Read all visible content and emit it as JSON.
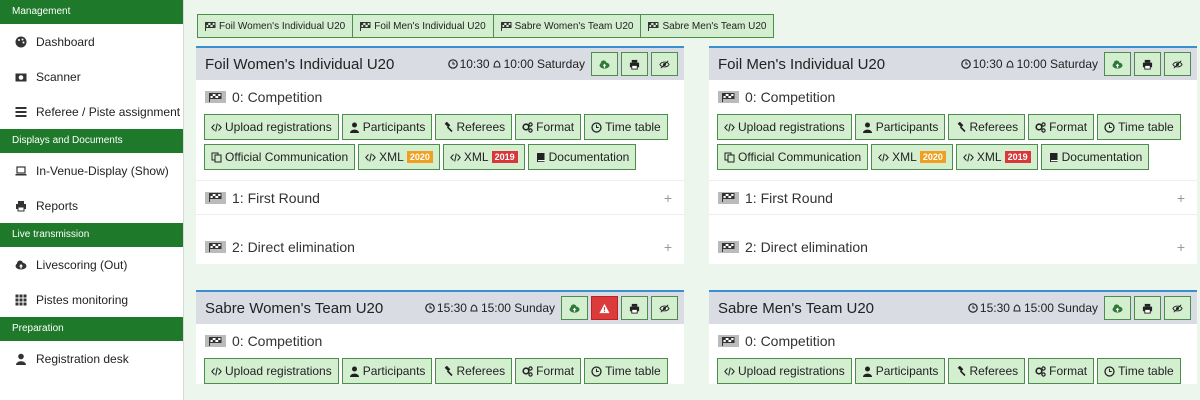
{
  "sidebar": {
    "sections": [
      {
        "title": "Management",
        "items": [
          {
            "label": "Dashboard",
            "icon": "palette-icon"
          },
          {
            "label": "Scanner",
            "icon": "camera-icon"
          },
          {
            "label": "Referee / Piste assignment",
            "icon": "list-icon"
          }
        ]
      },
      {
        "title": "Displays and Documents",
        "items": [
          {
            "label": "In-Venue-Display (Show)",
            "icon": "laptop-icon"
          },
          {
            "label": "Reports",
            "icon": "print-icon"
          }
        ]
      },
      {
        "title": "Live transmission",
        "items": [
          {
            "label": "Livescoring (Out)",
            "icon": "cloud-upload-icon"
          },
          {
            "label": "Pistes monitoring",
            "icon": "grid-icon"
          }
        ]
      },
      {
        "title": "Preparation",
        "items": [
          {
            "label": "Registration desk",
            "icon": "user-icon"
          }
        ]
      }
    ]
  },
  "tabs": [
    "Foil Women's Individual U20",
    "Foil Men's Individual U20",
    "Sabre Women's Team U20",
    "Sabre Men's Team U20"
  ],
  "cards": [
    {
      "title": "Foil Women's Individual U20",
      "start": "10:30",
      "check": "10:00 Saturday",
      "alert": false
    },
    {
      "title": "Foil Men's Individual U20",
      "start": "10:30",
      "check": "10:00 Saturday",
      "alert": false
    },
    {
      "title": "Sabre Women's Team U20",
      "start": "15:30",
      "check": "15:00 Sunday",
      "alert": true
    },
    {
      "title": "Sabre Men's Team U20",
      "start": "15:30",
      "check": "15:00 Sunday",
      "alert": false
    }
  ],
  "phases": {
    "competition": "0: Competition",
    "first_round": "1: First Round",
    "direct_elim": "2: Direct elimination"
  },
  "buttons": {
    "upload": "Upload registrations",
    "participants": "Participants",
    "referees": "Referees",
    "format": "Format",
    "timetable": "Time table",
    "official": "Official Communication",
    "xml": "XML",
    "badge2020": "2020",
    "badge2019": "2019",
    "documentation": "Documentation"
  },
  "colors": {
    "section": "#1e7a2a",
    "button_bg": "#d3efd0",
    "accent": "#3a8fd1",
    "danger": "#dc3b3b"
  }
}
